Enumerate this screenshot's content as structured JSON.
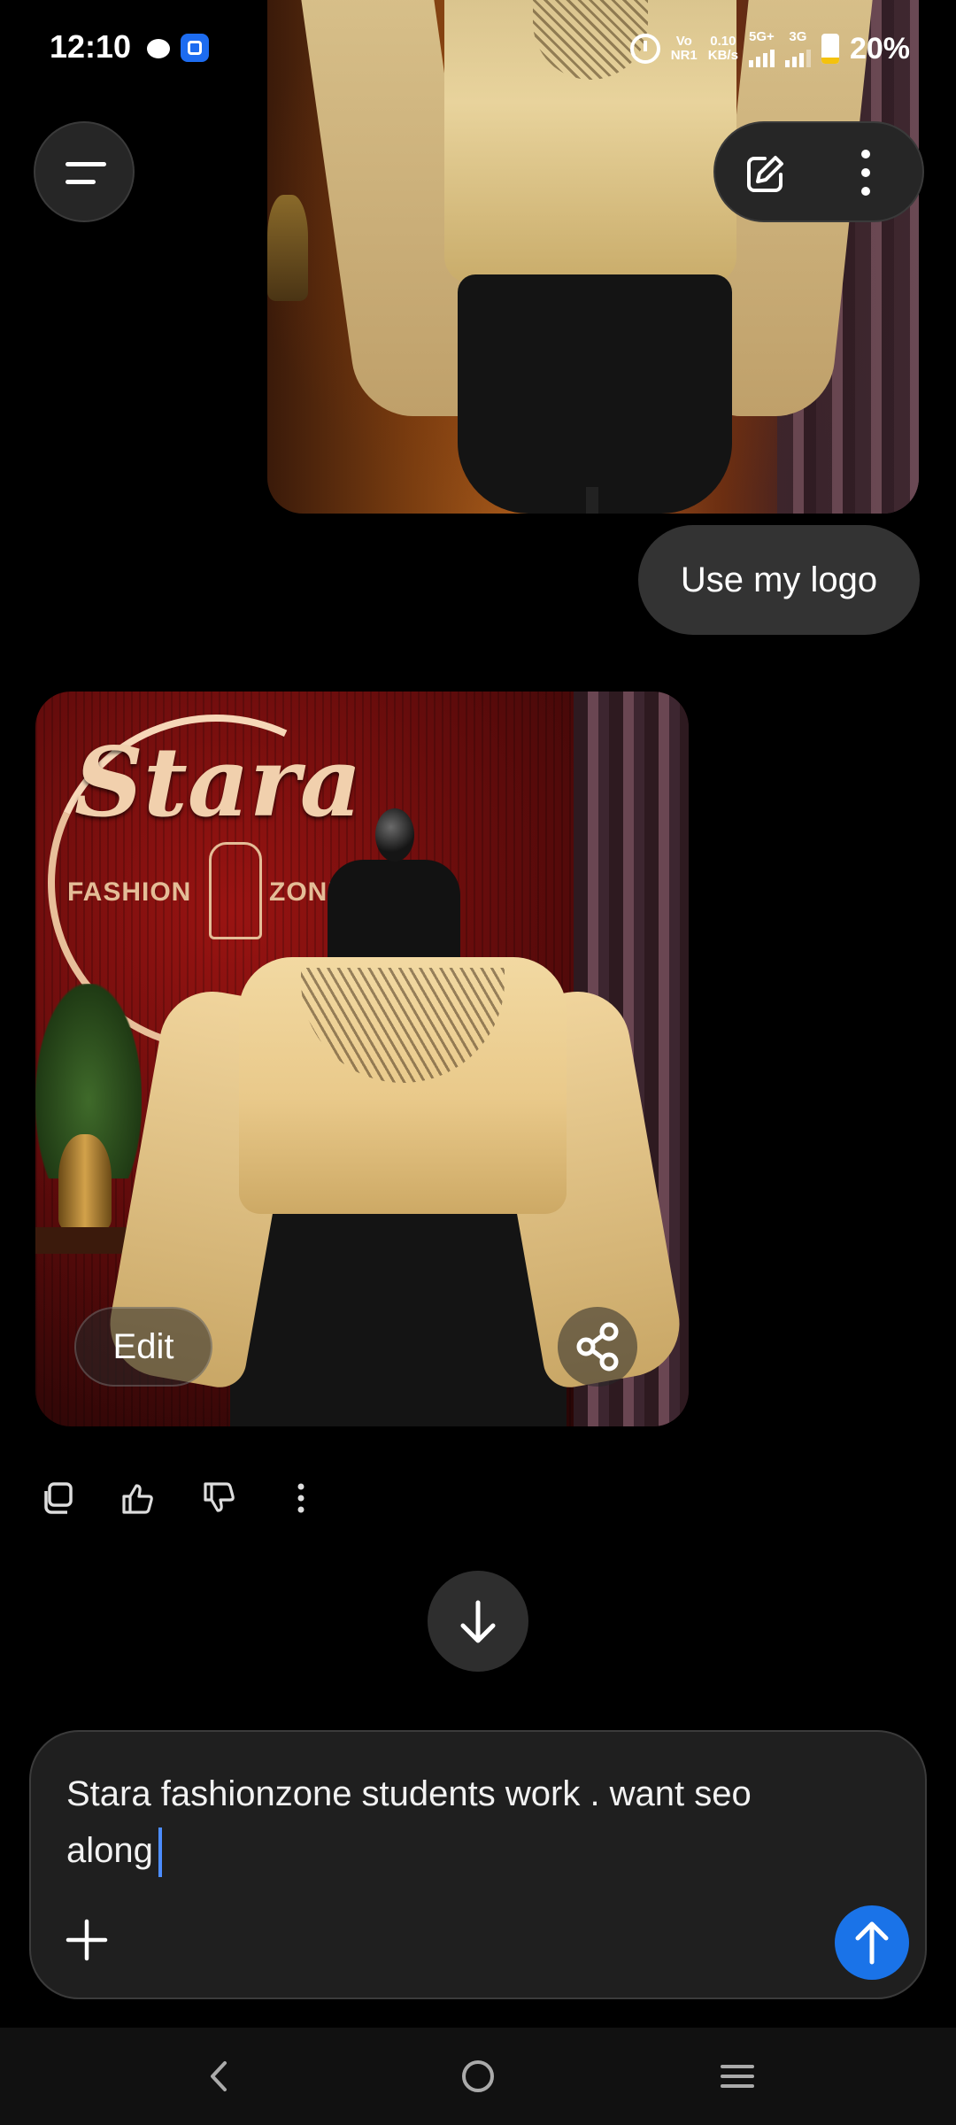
{
  "status_bar": {
    "time": "12:10",
    "vo": "Vo",
    "nr": "NR1",
    "speed": "0.10",
    "speed_unit": "KB/s",
    "net1": "5G+",
    "net2": "3G",
    "battery": "20%"
  },
  "conversation": {
    "user_message": "Use my logo",
    "generated_image": {
      "logo_script": "Stara",
      "logo_left": "FASHION",
      "logo_right": "ZONE",
      "edit_label": "Edit"
    }
  },
  "composer": {
    "text": "Stara fashionzone students work . want seo along"
  },
  "colors": {
    "accent": "#1a73e8",
    "caret": "#4c8dff",
    "bubble": "#333333",
    "background": "#000000"
  },
  "icons": {
    "menu": "menu-icon",
    "new_chat": "edit-icon",
    "more": "more-vertical-icon",
    "share": "share-icon",
    "copy": "copy-icon",
    "like": "thumbs-up-icon",
    "dislike": "thumbs-down-icon",
    "scroll_down": "arrow-down-icon",
    "attach": "plus-icon",
    "send": "arrow-up-icon"
  }
}
